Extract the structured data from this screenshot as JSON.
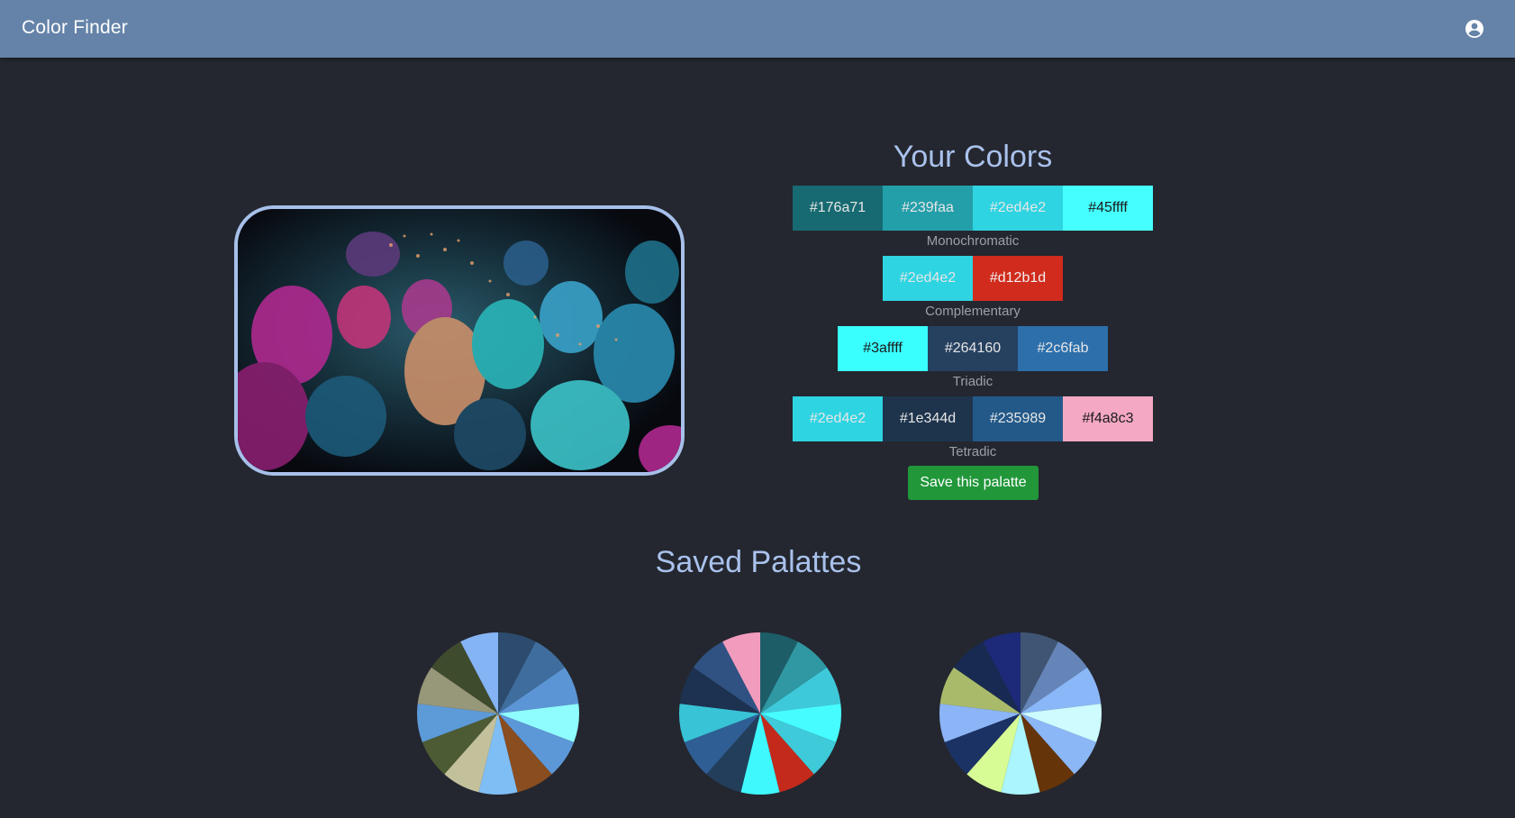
{
  "app": {
    "title": "Color Finder",
    "account_icon": "account-circle-icon"
  },
  "colors_section": {
    "title": "Your Colors",
    "palettes": [
      {
        "name": "Monochromatic",
        "swatches": [
          {
            "hex": "#176a71",
            "text_color": "#e6e6e6"
          },
          {
            "hex": "#239faa",
            "text_color": "#e6e6e6"
          },
          {
            "hex": "#2ed4e2",
            "text_color": "#e6e6e6"
          },
          {
            "hex": "#45ffff",
            "text_color": "#1a1a1a"
          }
        ]
      },
      {
        "name": "Complementary",
        "swatches": [
          {
            "hex": "#2ed4e2",
            "text_color": "#e6e6e6"
          },
          {
            "hex": "#d12b1d",
            "text_color": "#f0f0f0"
          }
        ]
      },
      {
        "name": "Triadic",
        "swatches": [
          {
            "hex": "#3affff",
            "text_color": "#1a1a1a"
          },
          {
            "hex": "#264160",
            "text_color": "#e6e6e6"
          },
          {
            "hex": "#2c6fab",
            "text_color": "#e6e6e6"
          }
        ]
      },
      {
        "name": "Tetradic",
        "swatches": [
          {
            "hex": "#2ed4e2",
            "text_color": "#e6e6e6"
          },
          {
            "hex": "#1e344d",
            "text_color": "#e6e6e6"
          },
          {
            "hex": "#235989",
            "text_color": "#e6e6e6"
          },
          {
            "hex": "#f4a8c3",
            "text_color": "#1a1a1a"
          }
        ]
      }
    ],
    "save_button_label": "Save this palatte"
  },
  "saved_section": {
    "title": "Saved Palattes",
    "pies": [
      {
        "colors": [
          "#2c4b6e",
          "#3f6d9e",
          "#5b95d5",
          "#8ffcfe",
          "#5c97d8",
          "#8a4d1f",
          "#7fbef5",
          "#c3c09c",
          "#4c5b33",
          "#5d9ad8",
          "#979779",
          "#3f4b2d",
          "#85b4f4"
        ]
      },
      {
        "colors": [
          "#1d5d68",
          "#2f98a3",
          "#3ec9da",
          "#46fcfe",
          "#3ecad9",
          "#c32a1c",
          "#3ff8fd",
          "#233e5b",
          "#2f5e94",
          "#39c3d7",
          "#1d3150",
          "#2f5283",
          "#f29cbd"
        ]
      },
      {
        "colors": [
          "#3f5573",
          "#6585b8",
          "#8ab7f7",
          "#cdfbfe",
          "#8bb7f7",
          "#653409",
          "#aaf5fe",
          "#d7fc96",
          "#1b3264",
          "#8bb5f7",
          "#a9bb6b",
          "#182a51",
          "#1c2a79"
        ]
      }
    ]
  }
}
